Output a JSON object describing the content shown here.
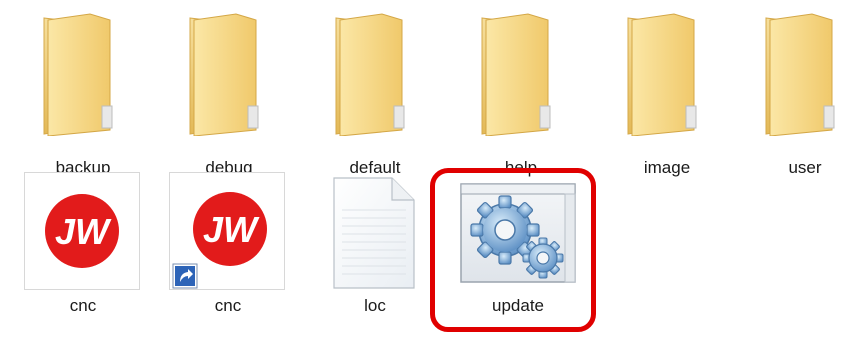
{
  "folders": [
    {
      "label": "backup",
      "icon": "folder-icon"
    },
    {
      "label": "debug",
      "icon": "folder-icon"
    },
    {
      "label": "default",
      "icon": "folder-icon"
    },
    {
      "label": "help",
      "icon": "folder-icon"
    },
    {
      "label": "image",
      "icon": "folder-icon"
    },
    {
      "label": "user",
      "icon": "folder-icon"
    }
  ],
  "files": [
    {
      "label": "cnc",
      "icon": "jw-app-icon",
      "logo_text": "JW"
    },
    {
      "label": "cnc",
      "icon": "jw-shortcut-icon",
      "logo_text": "JW",
      "shortcut": true
    },
    {
      "label": "loc",
      "icon": "text-document-icon"
    },
    {
      "label": "update",
      "icon": "gears-application-icon",
      "highlighted": true
    }
  ],
  "colors": {
    "highlight": "#e00000",
    "jw_red": "#e21b1b",
    "folder": "#f3d27a"
  }
}
